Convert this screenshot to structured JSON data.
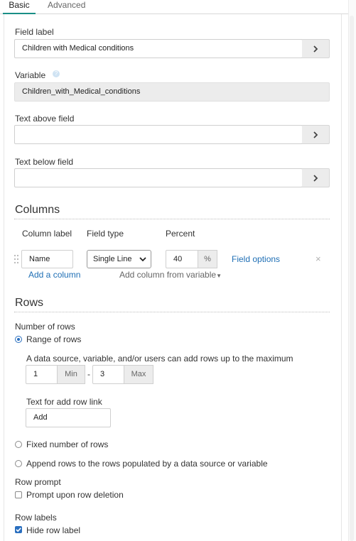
{
  "tabs": {
    "basic": "Basic",
    "advanced": "Advanced"
  },
  "field_label": {
    "label": "Field label",
    "value": "Children with Medical conditions"
  },
  "variable": {
    "label": "Variable",
    "value": "Children_with_Medical_conditions"
  },
  "text_above": {
    "label": "Text above field",
    "value": ""
  },
  "text_below": {
    "label": "Text below field",
    "value": ""
  },
  "columns": {
    "title": "Columns",
    "headers": {
      "label": "Column label",
      "type": "Field type",
      "percent": "Percent"
    },
    "row": {
      "name": "Name",
      "type": "Single Line",
      "percent": "40",
      "percent_addon": "%",
      "options_link": "Field options"
    },
    "add_column": "Add a column",
    "add_from_variable": "Add column from variable"
  },
  "rows": {
    "title": "Rows",
    "number_label": "Number of rows",
    "range_label": "Range of rows",
    "range_help": "A data source, variable, and/or users can add rows up to the maximum",
    "min_value": "1",
    "min_addon": "Min",
    "dash": "-",
    "max_value": "3",
    "max_addon": "Max",
    "add_link_label": "Text for add row link",
    "add_link_value": "Add",
    "fixed_label": "Fixed number of rows",
    "append_label": "Append rows to the rows populated by a data source or variable"
  },
  "row_prompt": {
    "title": "Row prompt",
    "option": "Prompt upon row deletion"
  },
  "row_labels": {
    "title": "Row labels",
    "option": "Hide row label"
  },
  "colors": {
    "accent_tab": "#1a8f86",
    "link": "#1f6fb5",
    "check": "#2a6fbf"
  }
}
